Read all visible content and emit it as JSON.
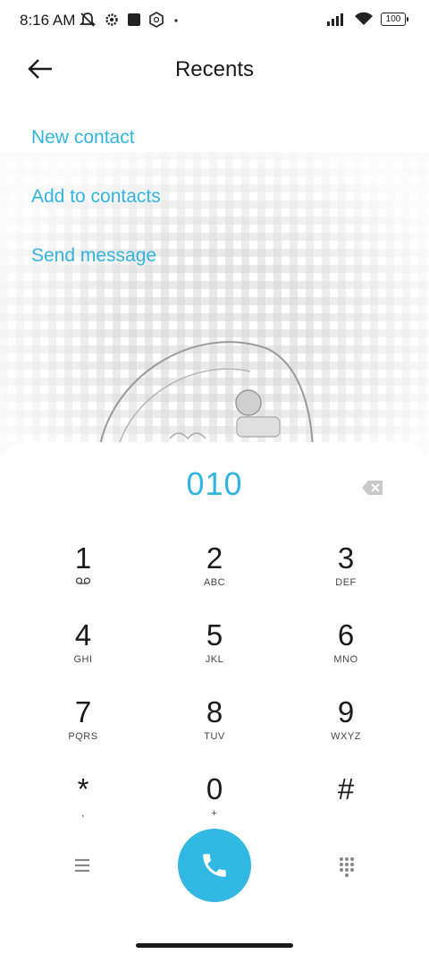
{
  "status_bar": {
    "time": "8:16 AM",
    "battery": "100",
    "icons_left": [
      "muted-bell-icon",
      "settings-gear-icon",
      "square-app-icon",
      "shield-app-icon",
      "dot-icon"
    ],
    "icons_right": [
      "signal-icon",
      "wifi-icon",
      "battery-icon"
    ]
  },
  "header": {
    "title": "Recents",
    "back_icon": "back-arrow-icon"
  },
  "actions": [
    {
      "label": "New contact"
    },
    {
      "label": "Add to contacts"
    },
    {
      "label": "Send message"
    }
  ],
  "dialer": {
    "number": "010",
    "backspace_icon": "backspace-icon",
    "keys": [
      [
        {
          "digit": "1",
          "sub": ""
        },
        {
          "digit": "2",
          "sub": "ABC"
        },
        {
          "digit": "3",
          "sub": "DEF"
        }
      ],
      [
        {
          "digit": "4",
          "sub": "GHI"
        },
        {
          "digit": "5",
          "sub": "JKL"
        },
        {
          "digit": "6",
          "sub": "MNO"
        }
      ],
      [
        {
          "digit": "7",
          "sub": "PQRS"
        },
        {
          "digit": "8",
          "sub": "TUV"
        },
        {
          "digit": "9",
          "sub": "WXYZ"
        }
      ],
      [
        {
          "digit": "*",
          "sub": ","
        },
        {
          "digit": "0",
          "sub": "+"
        },
        {
          "digit": "#",
          "sub": ""
        }
      ]
    ],
    "voicemail_icon": "voicemail-icon",
    "menu_icon": "menu-icon",
    "call_icon": "phone-icon",
    "dialpad_icon": "dialpad-icon"
  },
  "colors": {
    "accent": "#33b4e0",
    "call_button": "#31b8e3",
    "text": "#1a1a1a"
  }
}
